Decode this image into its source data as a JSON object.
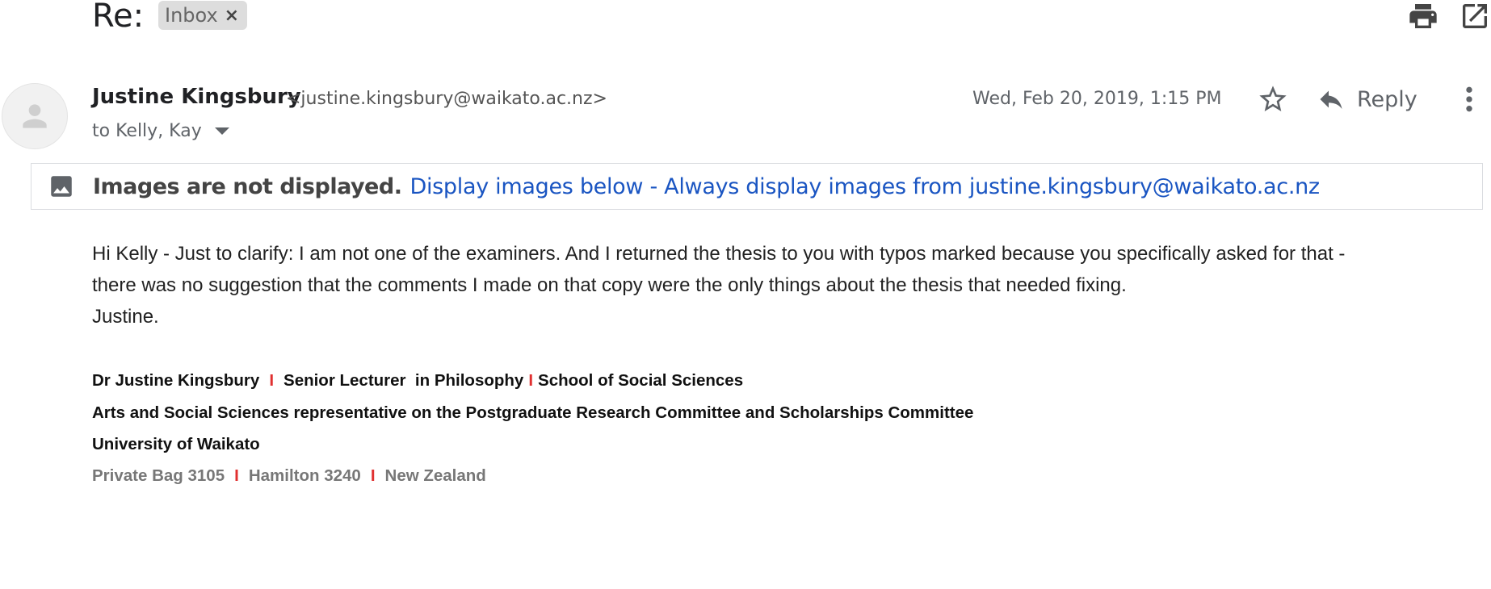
{
  "header": {
    "subject": "Re:",
    "label": "Inbox",
    "label_remove": "×",
    "icons": [
      "print-icon",
      "open-in-new-window-icon"
    ]
  },
  "message": {
    "sender_name": "Justine Kingsbury",
    "sender_email": "<justine.kingsbury@waikato.ac.nz>",
    "recipients": "to Kelly, Kay",
    "date": "Wed, Feb 20, 2019, 1:15 PM",
    "reply_label": "Reply"
  },
  "images_banner": {
    "notice": "Images are not displayed.",
    "link_text": "Display images below - Always display images from justine.kingsbury@waikato.ac.nz"
  },
  "body": {
    "line1": "Hi Kelly - Just to clarify: I am not one of the examiners. And I returned the thesis to you with typos marked because you specifically asked for that -",
    "line2": "there was no suggestion that the comments I made on that copy were the only things about the thesis that needed fixing.",
    "line3": "Justine."
  },
  "signature": {
    "name": "Dr Justine Kingsbury",
    "title": "Senior Lecturer  in Philosophy",
    "school": "School of Social Sciences",
    "separator": "I",
    "role": "Arts and Social Sciences representative on the Postgraduate Research Committee and Scholarships Committee",
    "university": "University of Waikato",
    "address1": "Private Bag 3105",
    "address2": "Hamilton 3240",
    "address3": "New Zealand"
  },
  "colors": {
    "link": "#1a55c2",
    "separator": "#e03030"
  }
}
